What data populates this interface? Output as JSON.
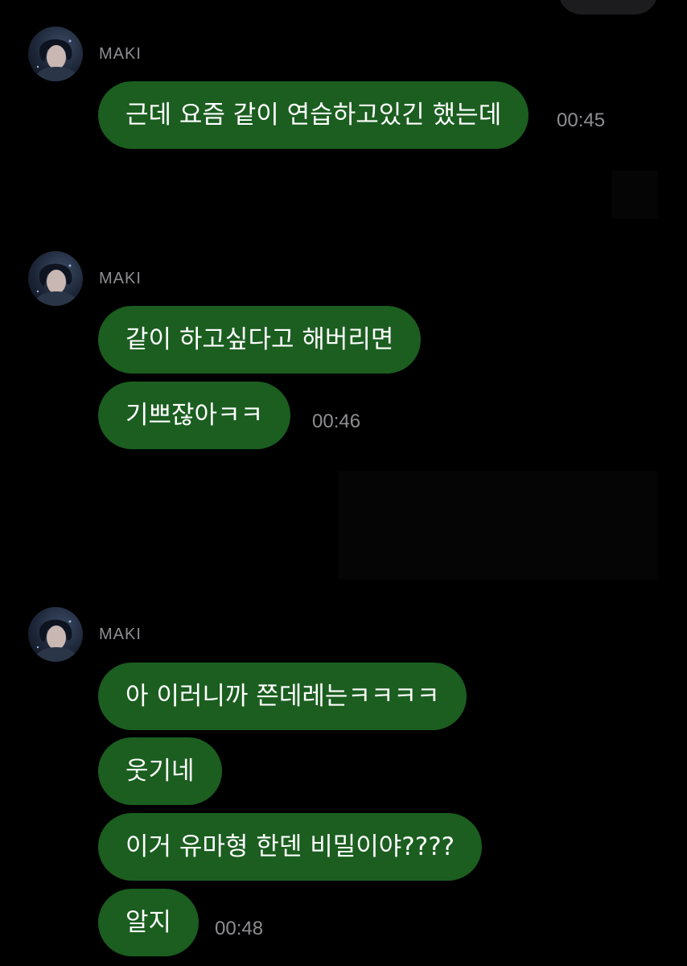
{
  "colors": {
    "background": "#000000",
    "bubble": "#1b5e20",
    "meta_text": "#8e8e93"
  },
  "groups": [
    {
      "sender": "MAKI",
      "messages": [
        {
          "text": "근데 요즘 같이 연습하고있긴 했는데",
          "time": "00:45"
        }
      ]
    },
    {
      "sender": "MAKI",
      "messages": [
        {
          "text": "같이 하고싶다고 해버리면"
        },
        {
          "text": "기쁘잖아ㅋㅋ",
          "time": "00:46"
        }
      ]
    },
    {
      "sender": "MAKI",
      "messages": [
        {
          "text": "아 이러니까 쯘데레는ㅋㅋㅋㅋ"
        },
        {
          "text": "웃기네"
        },
        {
          "text": "이거 유마형 한덴 비밀이야????"
        },
        {
          "text": "알지",
          "time": "00:48"
        }
      ]
    }
  ]
}
